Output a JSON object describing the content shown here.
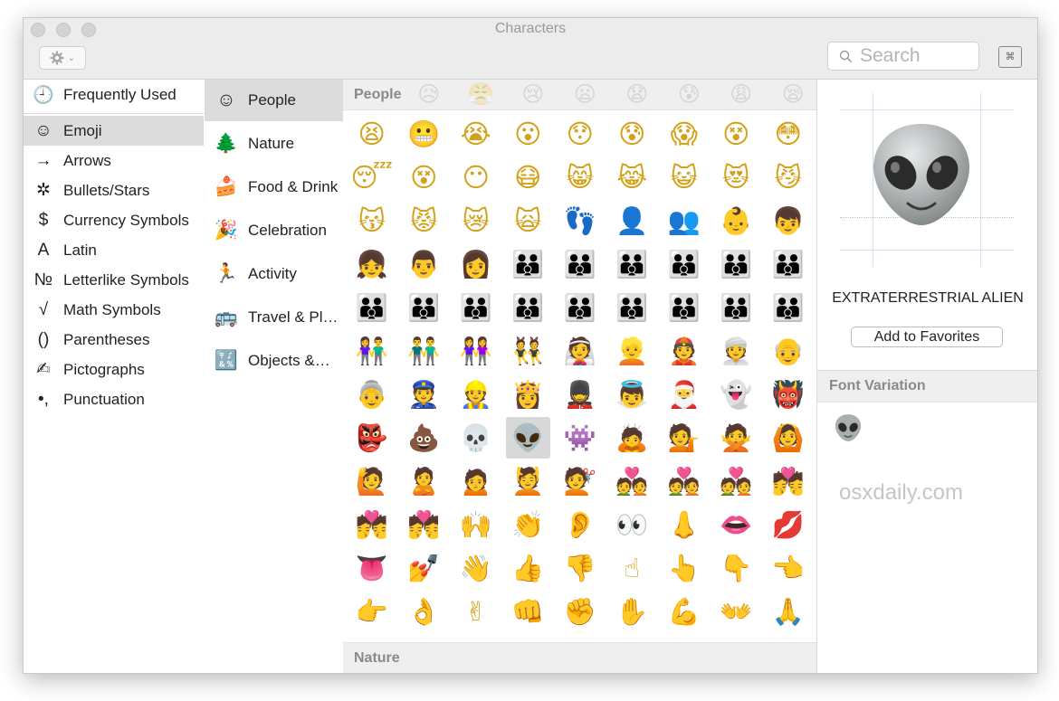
{
  "window": {
    "title": "Characters"
  },
  "toolbar": {
    "gear_icon": "gear-icon",
    "chevron": "⌄"
  },
  "search": {
    "placeholder": "Search"
  },
  "keyboard_viewer": {
    "glyph": "⌘"
  },
  "sidebar": {
    "items": [
      {
        "label": "Frequently Used",
        "icon": "clock-icon",
        "glyph": "🕘"
      },
      {
        "label": "Emoji",
        "icon": "smiley-icon",
        "glyph": "☺"
      },
      {
        "label": "Arrows",
        "icon": "arrow-icon",
        "glyph": "→"
      },
      {
        "label": "Bullets/Stars",
        "icon": "asterisk-icon",
        "glyph": "✲"
      },
      {
        "label": "Currency Symbols",
        "icon": "dollar-icon",
        "glyph": "$"
      },
      {
        "label": "Latin",
        "icon": "letter-a-icon",
        "glyph": "A"
      },
      {
        "label": "Letterlike Symbols",
        "icon": "numero-icon",
        "glyph": "№"
      },
      {
        "label": "Math Symbols",
        "icon": "square-root-icon",
        "glyph": "√"
      },
      {
        "label": "Parentheses",
        "icon": "parentheses-icon",
        "glyph": "()"
      },
      {
        "label": "Pictographs",
        "icon": "pen-hand-icon",
        "glyph": "✍"
      },
      {
        "label": "Punctuation",
        "icon": "punctuation-icon",
        "glyph": "•,"
      }
    ],
    "selected": "Emoji"
  },
  "subcategories": {
    "items": [
      {
        "label": "People",
        "icon": "smiley-face-icon",
        "glyph": "☺"
      },
      {
        "label": "Nature",
        "icon": "tree-icon",
        "glyph": "🌲"
      },
      {
        "label": "Food & Drink",
        "icon": "cake-icon",
        "glyph": "🍰"
      },
      {
        "label": "Celebration",
        "icon": "party-popper-icon",
        "glyph": "🎉"
      },
      {
        "label": "Activity",
        "icon": "runner-icon",
        "glyph": "🏃"
      },
      {
        "label": "Travel & Pl…",
        "icon": "bus-icon",
        "glyph": "🚌"
      },
      {
        "label": "Objects &…",
        "icon": "symbols-icon",
        "glyph": "🔣"
      }
    ],
    "selected": "People"
  },
  "grid": {
    "top_header": "People",
    "bottom_header": "Nature",
    "ghost_row": [
      "😥",
      "😤",
      "😢",
      "😦",
      "😧",
      "😰",
      "😩",
      "😪"
    ],
    "emoji": [
      "😫",
      "😬",
      "😭",
      "😮",
      "😯",
      "😰",
      "😱",
      "😵",
      "😳",
      "😴",
      "😵",
      "😶",
      "😷",
      "😸",
      "😹",
      "😺",
      "😻",
      "😼",
      "😽",
      "😾",
      "😿",
      "🙀",
      "👣",
      "👤",
      "👥",
      "👶",
      "👦",
      "👧",
      "👨",
      "👩",
      "👪",
      "👪",
      "👪",
      "👪",
      "👪",
      "👪",
      "👪",
      "👪",
      "👪",
      "👪",
      "👪",
      "👪",
      "👪",
      "👪",
      "👪",
      "👫",
      "👬",
      "👭",
      "👯",
      "👰",
      "👱",
      "👲",
      "👳",
      "👴",
      "👵",
      "👮",
      "👷",
      "👸",
      "💂",
      "👼",
      "🎅",
      "👻",
      "👹",
      "👺",
      "💩",
      "💀",
      "👽",
      "👾",
      "🙇",
      "💁",
      "🙅",
      "🙆",
      "🙋",
      "🙎",
      "🙍",
      "💆",
      "💇",
      "💑",
      "💑",
      "💑",
      "💏",
      "💏",
      "💏",
      "🙌",
      "👏",
      "👂",
      "👀",
      "👃",
      "👄",
      "💋",
      "👅",
      "💅",
      "👋",
      "👍",
      "👎",
      "☝",
      "👆",
      "👇",
      "👈",
      "👉",
      "👌",
      "✌",
      "👊",
      "✊",
      "✋",
      "💪",
      "👐",
      "🙏"
    ],
    "selected_emoji": "👽"
  },
  "detail": {
    "character_name": "EXTRATERRESTRIAL ALIEN",
    "favorites_label": "Add to Favorites",
    "font_variation_header": "Font Variation",
    "watermark": "osxdaily.com"
  },
  "colors": {
    "emoji_yellow": "#f6c344",
    "alien_gray": "#a9aeae",
    "selection_gray": "#dcdcdc",
    "header_gray": "#8a8a8a"
  }
}
